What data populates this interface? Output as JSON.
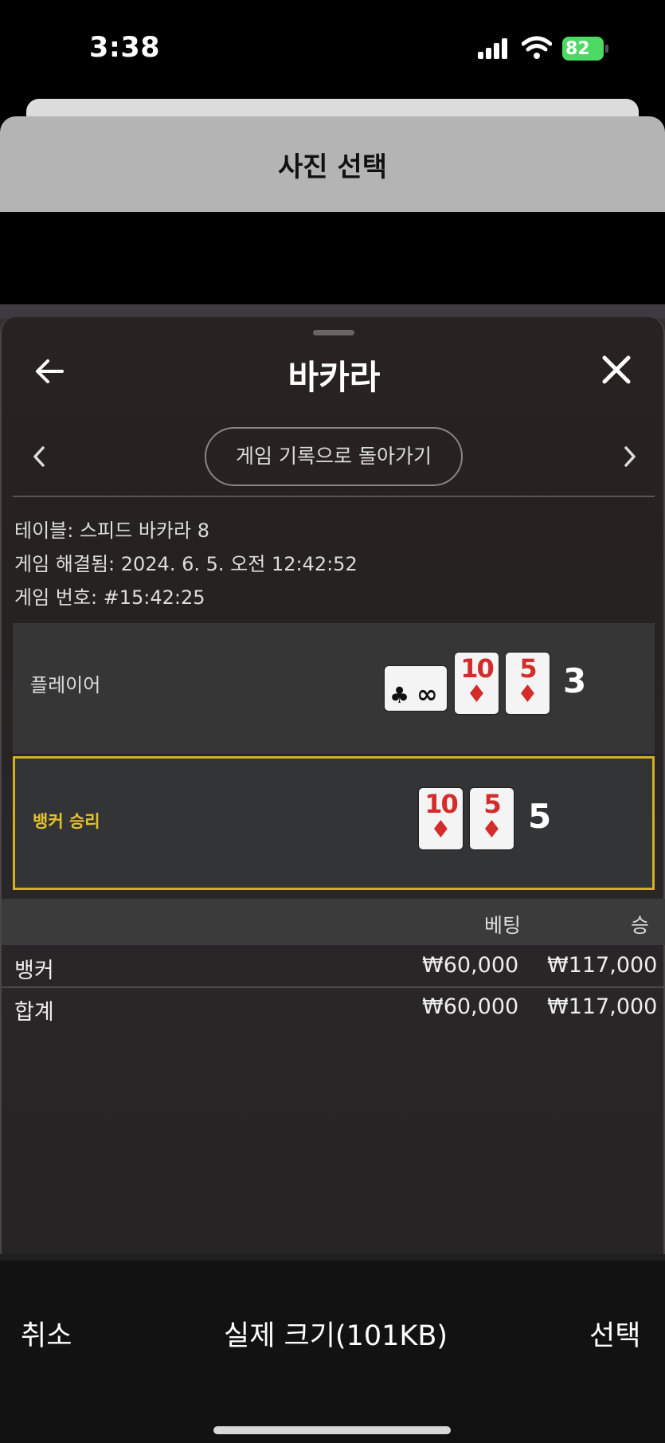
{
  "status_bar": {
    "time": "3:38",
    "battery": "82"
  },
  "sheet": {
    "title": "사진 선택"
  },
  "panel": {
    "title": "바카라",
    "history_button": "게임 기록으로 돌아가기",
    "info": {
      "table": "테이블: 스피드 바카라 8",
      "resolved": "게임 해결됨: 2024. 6. 5. 오전 12:42:52",
      "number": "게임 번호: #15:42:25"
    },
    "player": {
      "label": "플레이어",
      "score": "3",
      "cards": [
        {
          "rank": "10",
          "suit": "♦"
        },
        {
          "rank": "5",
          "suit": "♦"
        }
      ],
      "side_card": {
        "suit": "♣",
        "rank": "∞"
      }
    },
    "banker": {
      "label": "뱅커 승리",
      "score": "5",
      "cards": [
        {
          "rank": "10",
          "suit": "♦"
        },
        {
          "rank": "5",
          "suit": "♦"
        }
      ]
    },
    "table": {
      "headers": {
        "bet": "베팅",
        "win": "승"
      },
      "rows": [
        {
          "label": "뱅커",
          "bet": "₩60,000",
          "win": "₩117,000"
        },
        {
          "label": "합계",
          "bet": "₩60,000",
          "win": "₩117,000"
        }
      ]
    }
  },
  "toolbar": {
    "cancel": "취소",
    "size": "실제 크기(101KB)",
    "select": "선택"
  },
  "colors": {
    "accent_gold": "#d2b01e",
    "card_red": "#d42b2b",
    "battery_green": "#4cd964"
  }
}
